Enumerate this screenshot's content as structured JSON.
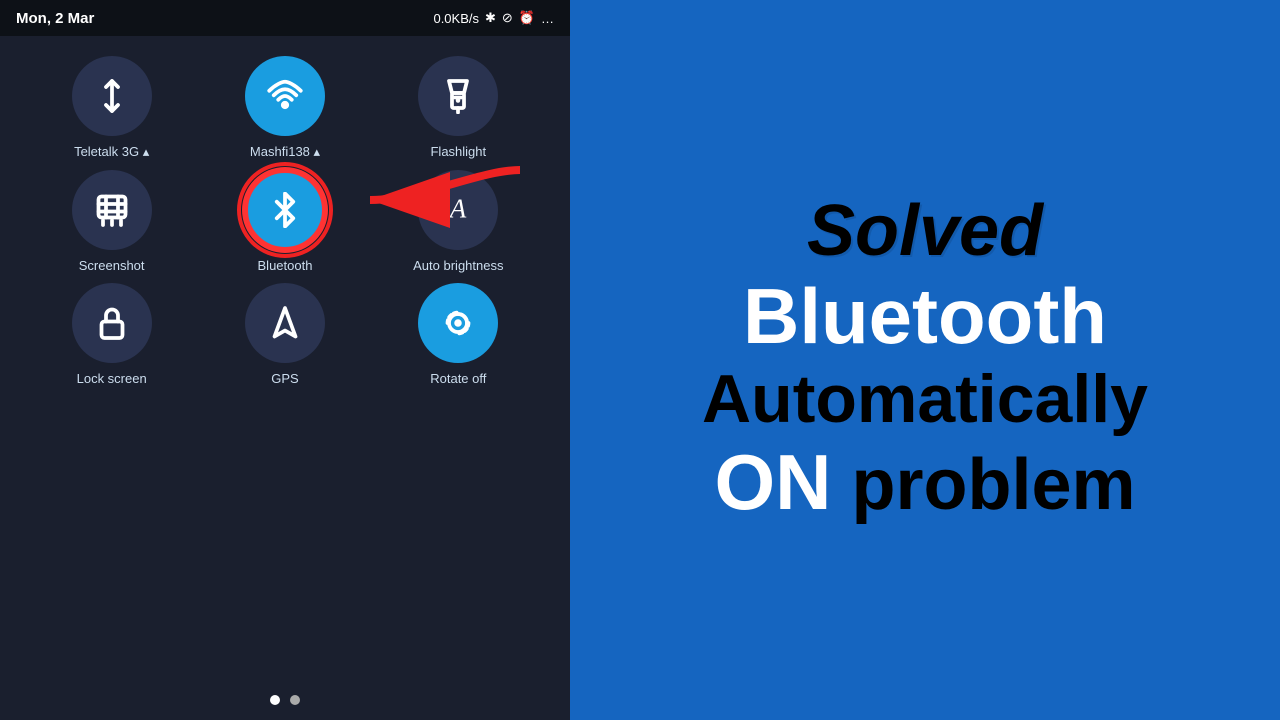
{
  "status_bar": {
    "date": "Mon, 2 Mar",
    "network_speed": "0.0KB/s",
    "dots": "●●"
  },
  "quick_settings": {
    "row1": [
      {
        "label": "Teletalk 3G",
        "icon": "data",
        "active": false
      },
      {
        "label": "Mashfi138",
        "icon": "wifi",
        "active": true
      },
      {
        "label": "Flashlight",
        "icon": "flashlight",
        "active": false
      }
    ],
    "row2": [
      {
        "label": "Screenshot",
        "icon": "screenshot",
        "active": false
      },
      {
        "label": "Bluetooth",
        "icon": "bluetooth",
        "active": true
      },
      {
        "label": "Auto brightness",
        "icon": "brightness",
        "active": false
      }
    ],
    "row3": [
      {
        "label": "Lock screen",
        "icon": "lock",
        "active": false
      },
      {
        "label": "GPS",
        "icon": "gps",
        "active": false
      },
      {
        "label": "Rotate off",
        "icon": "rotate",
        "active": true
      }
    ]
  },
  "pagination": {
    "current": 0,
    "total": 2
  },
  "right_panel": {
    "line1": "Solved",
    "line2": "Bluetooth",
    "line3": "Automatically",
    "line4": "ON",
    "line5": "problem"
  }
}
